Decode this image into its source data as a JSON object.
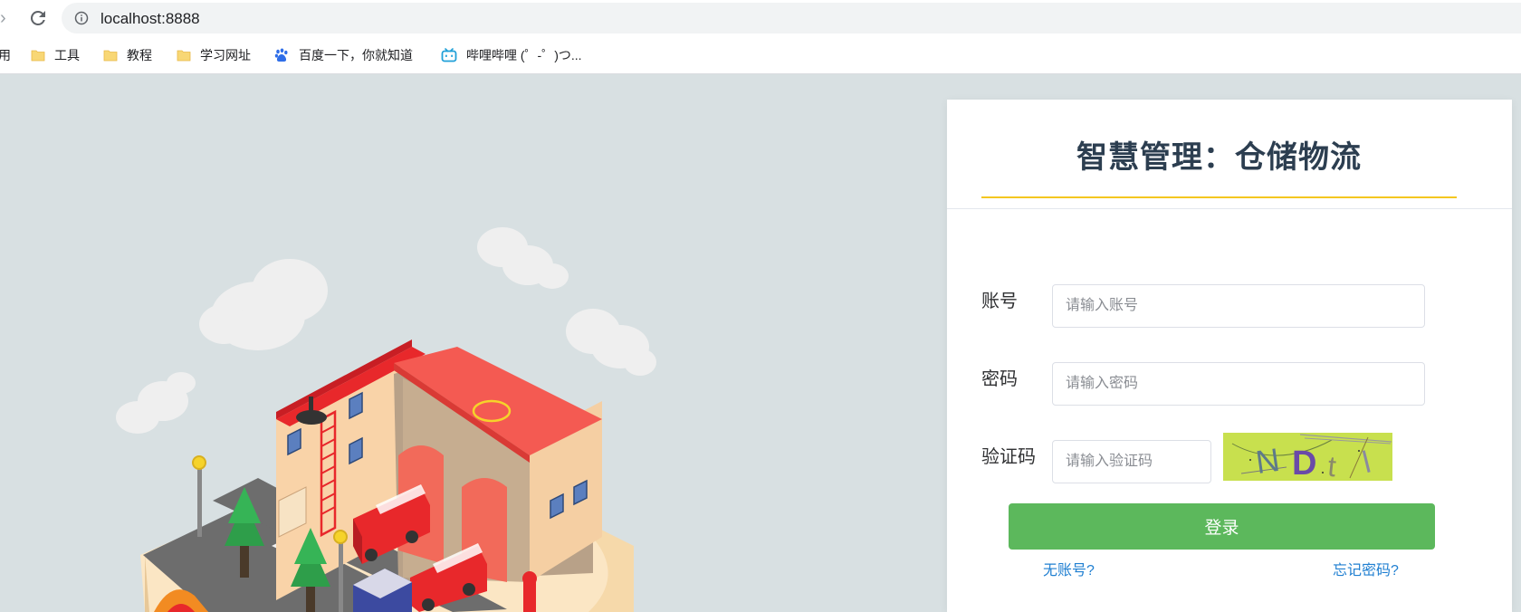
{
  "browser": {
    "url": "localhost:8888",
    "bookmarks": [
      {
        "label": "用",
        "icon": "none"
      },
      {
        "label": "工具",
        "icon": "folder-icon"
      },
      {
        "label": "教程",
        "icon": "folder-icon"
      },
      {
        "label": "学习网址",
        "icon": "folder-icon"
      },
      {
        "label": "百度一下，你就知道",
        "icon": "baidu-paw-icon"
      },
      {
        "label": "哔哩哔哩 (゜-゜)つ...",
        "icon": "bilibili-tv-icon"
      }
    ]
  },
  "login": {
    "title": "智慧管理：仓储物流",
    "account_label": "账号",
    "account_placeholder": "请输入账号",
    "password_label": "密码",
    "password_placeholder": "请输入密码",
    "captcha_label": "验证码",
    "captcha_placeholder": "请输入验证码",
    "captcha_text": [
      "N",
      "D",
      "t",
      "l"
    ],
    "login_button": "登录",
    "no_account_link": "无账号?",
    "forgot_password_link": "忘记密码?"
  },
  "colors": {
    "page_background": "#d8e0e2",
    "accent_underline": "#f4c720",
    "login_button": "#5cb85c",
    "link": "#1f7fd1",
    "captcha_background": "#c8e04e"
  }
}
